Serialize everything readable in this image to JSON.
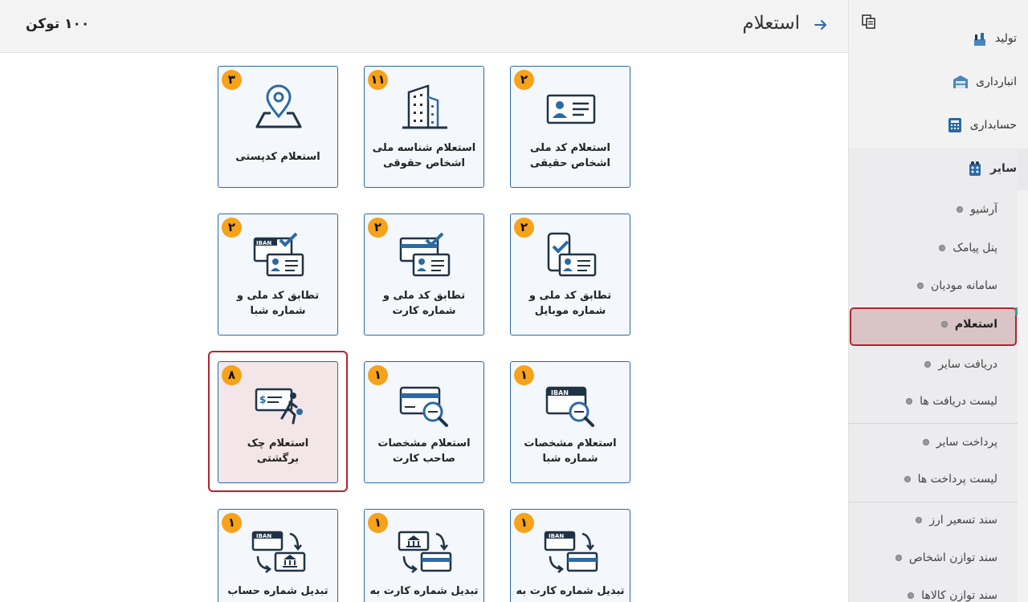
{
  "header": {
    "title": "استعلام",
    "token_text": "۱۰۰ توکن"
  },
  "tiles": [
    {
      "label1": "استعلام کد ملی",
      "label2": "اشخاص حقیقی",
      "count": "۲",
      "icon": "id-card-icon"
    },
    {
      "label1": "استعلام شناسه ملی",
      "label2": "اشخاص حقوقی",
      "count": "۱۱",
      "icon": "building-icon"
    },
    {
      "label1": "استعلام کدپستی",
      "label2": "",
      "count": "۳",
      "icon": "location-pin-icon"
    },
    {
      "label1": "تطابق کد ملی و",
      "label2": "شماره موبایل",
      "count": "۲",
      "icon": "mobile-id-check-icon"
    },
    {
      "label1": "تطابق کد ملی و",
      "label2": "شماره کارت",
      "count": "۲",
      "icon": "card-id-check-icon"
    },
    {
      "label1": "تطابق کد ملی و",
      "label2": "شماره شبا",
      "count": "۲",
      "icon": "iban-id-check-icon"
    },
    {
      "label1": "استعلام مشخصات",
      "label2": "شماره شبا",
      "count": "۱",
      "icon": "iban-search-icon"
    },
    {
      "label1": "استعلام مشخصات",
      "label2": "صاحب کارت",
      "count": "۱",
      "icon": "card-search-icon"
    },
    {
      "label1": "استعلام چک",
      "label2": "برگشتی",
      "count": "۸",
      "icon": "bounced-check-icon"
    },
    {
      "label1": "تبدیل شماره کارت به",
      "label2": "",
      "count": "۱",
      "icon": "card-to-iban-icon"
    },
    {
      "label1": "تبدیل شماره کارت به",
      "label2": "",
      "count": "۱",
      "icon": "card-to-account-icon"
    },
    {
      "label1": "تبدیل شماره حساب",
      "label2": "",
      "count": "۱",
      "icon": "account-to-iban-icon"
    }
  ],
  "sidebar": {
    "main_items": [
      {
        "label": "تولید",
        "icon": "factory-icon"
      },
      {
        "label": "انبارداری",
        "icon": "warehouse-icon"
      },
      {
        "label": "حسابداری",
        "icon": "calculator-icon"
      },
      {
        "label": "سایر",
        "icon": "other-icon"
      }
    ],
    "sub_items": [
      "آرشیو",
      "پنل پیامک",
      "سامانه مودیان",
      "استعلام",
      "دریافت سایر",
      "لیست دریافت ها",
      "پرداخت سایر",
      "لیست پرداخت ها",
      "سند تسعیر ارز",
      "سند توازن اشخاص",
      "سند توازن کالاها"
    ],
    "active_item": "استعلام"
  },
  "colors": {
    "accent": "#2b6aa5",
    "badge": "#f6a21a",
    "active_border": "#b0262d"
  }
}
